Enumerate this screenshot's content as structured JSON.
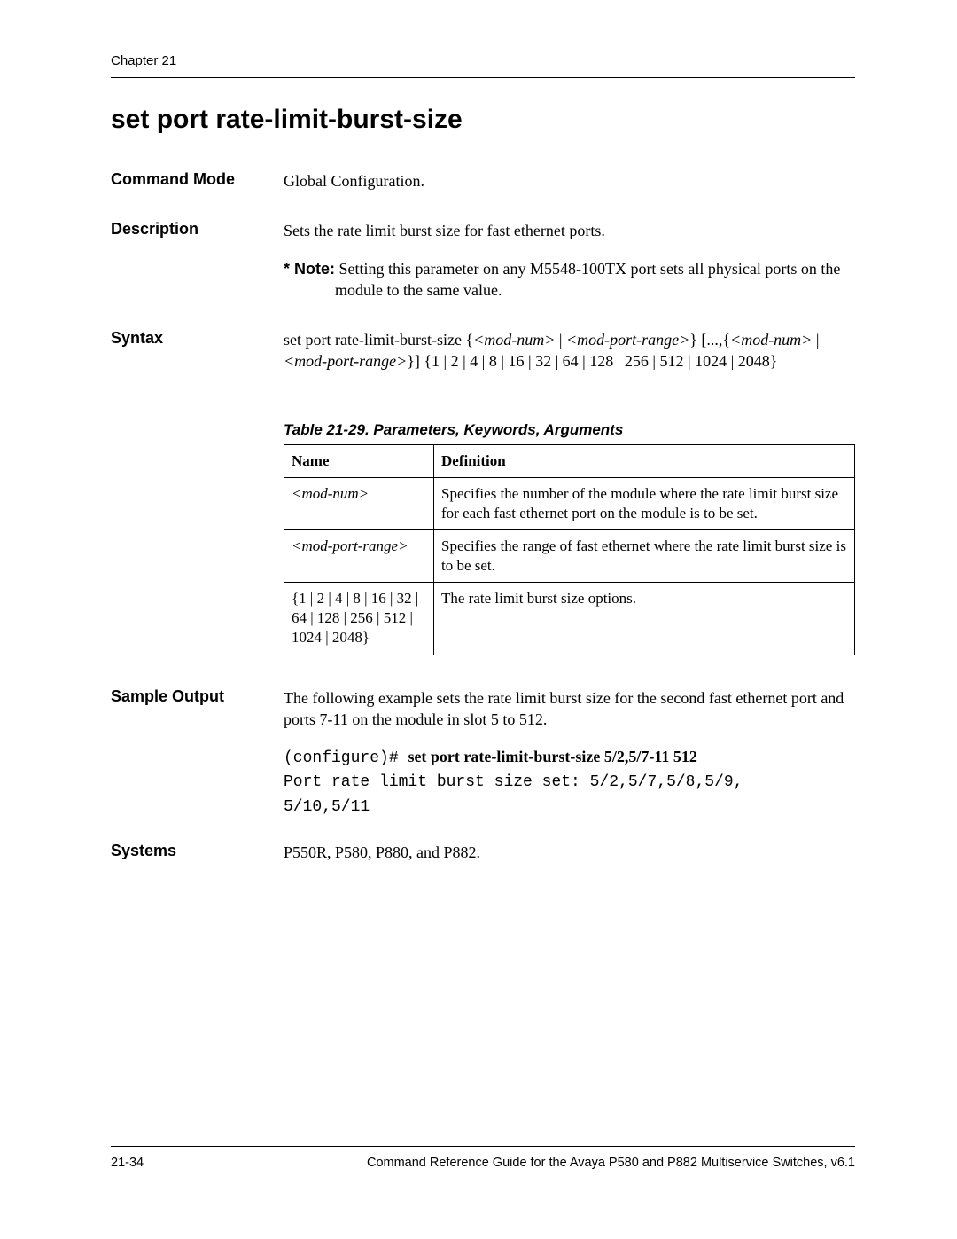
{
  "chapter": "Chapter 21",
  "title": "set port rate-limit-burst-size",
  "rows": {
    "commandMode": {
      "label": "Command Mode",
      "value": "Global Configuration."
    },
    "description": {
      "label": "Description",
      "value": "Sets the rate limit burst size for fast ethernet ports.",
      "notePrefix": "* Note:",
      "noteText": " Setting this parameter on any M5548-100TX port sets all physical ports on the module to the same value."
    },
    "syntax": {
      "label": "Syntax",
      "parts": {
        "p1": "set port rate-limit-burst-size {",
        "p2": "<mod-num>",
        "p3": " | ",
        "p4": "<mod-port-range>",
        "p5": "} [...,{",
        "p6": "<mod-num>",
        "p7": " | ",
        "p8": "<mod-port-range>",
        "p9": "}] {1 | 2 | 4 | 8 | 16 | 32 | 64 | 128 | 256 | 512 | 1024 | 2048}"
      }
    },
    "sampleOutput": {
      "label": "Sample Output",
      "intro": "The following example sets the rate limit burst size for the second fast ethernet port and ports 7-11 on the module in slot 5 to 512.",
      "prompt": "(configure)# ",
      "command": "set port rate-limit-burst-size 5/2,5/7-11 512",
      "outputLine1": "Port rate limit burst size set: 5/2,5/7,5/8,5/9,",
      "outputLine2": "5/10,5/11"
    },
    "systems": {
      "label": "Systems",
      "value": "P550R, P580, P880, and P882."
    }
  },
  "table": {
    "caption": "Table 21-29.  Parameters, Keywords, Arguments",
    "headers": {
      "name": "Name",
      "definition": "Definition"
    },
    "rows": [
      {
        "name": "<mod-num>",
        "nameItalic": true,
        "def": "Specifies the number of the module where the rate limit burst size for each fast ethernet port on the module is to be set."
      },
      {
        "name": "<mod-port-range>",
        "nameItalic": true,
        "def": "Specifies the range of fast ethernet where the rate limit burst size is to be set."
      },
      {
        "name": "{1 | 2 | 4 | 8 | 16 | 32 | 64 | 128 | 256 | 512 | 1024 | 2048}",
        "nameItalic": false,
        "def": "The rate limit burst size options."
      }
    ]
  },
  "footer": {
    "left": "21-34",
    "right": "Command Reference Guide for the Avaya P580 and P882 Multiservice Switches, v6.1"
  }
}
